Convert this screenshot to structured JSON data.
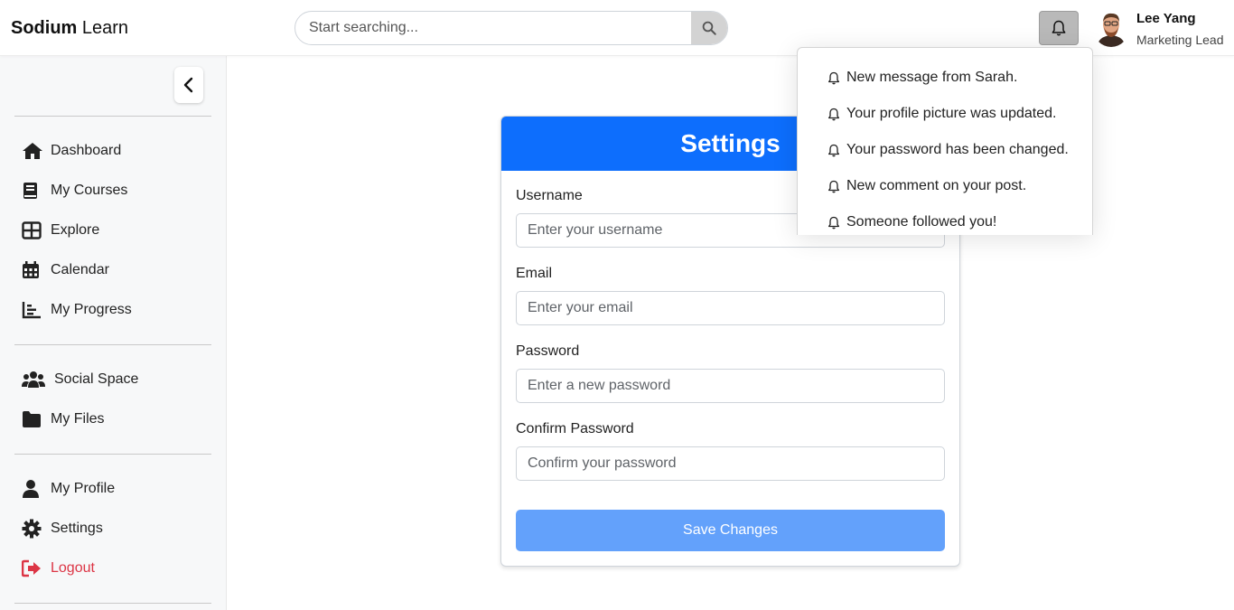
{
  "header": {
    "brand_bold": "Sodium",
    "brand_light": "Learn",
    "search_placeholder": "Start searching...",
    "user_name": "Lee Yang",
    "user_role": "Marketing Lead"
  },
  "sidebar": {
    "group1": [
      {
        "label": "Dashboard",
        "icon": "home-icon"
      },
      {
        "label": "My Courses",
        "icon": "book-icon"
      },
      {
        "label": "Explore",
        "icon": "grid-icon"
      },
      {
        "label": "Calendar",
        "icon": "calendar-icon"
      },
      {
        "label": "My Progress",
        "icon": "chart-icon"
      }
    ],
    "group2": [
      {
        "label": "Social Space",
        "icon": "users-icon"
      },
      {
        "label": "My Files",
        "icon": "folder-icon"
      }
    ],
    "group3": [
      {
        "label": "My Profile",
        "icon": "user-icon"
      },
      {
        "label": "Settings",
        "icon": "gear-icon"
      },
      {
        "label": "Logout",
        "icon": "logout-icon"
      }
    ]
  },
  "settings": {
    "title": "Settings",
    "fields": [
      {
        "label": "Username",
        "placeholder": "Enter your username"
      },
      {
        "label": "Email",
        "placeholder": "Enter your email"
      },
      {
        "label": "Password",
        "placeholder": "Enter a new password"
      },
      {
        "label": "Confirm Password",
        "placeholder": "Confirm your password"
      }
    ],
    "save_label": "Save Changes"
  },
  "notifications": [
    "New message from Sarah.",
    "Your profile picture was updated.",
    "Your password has been changed.",
    "New comment on your post.",
    "Someone followed you!"
  ],
  "colors": {
    "primary": "#0d6efd",
    "save_button": "#63a1fb",
    "logout": "#dc3545",
    "sidebar_bg": "#f7f8f9"
  }
}
